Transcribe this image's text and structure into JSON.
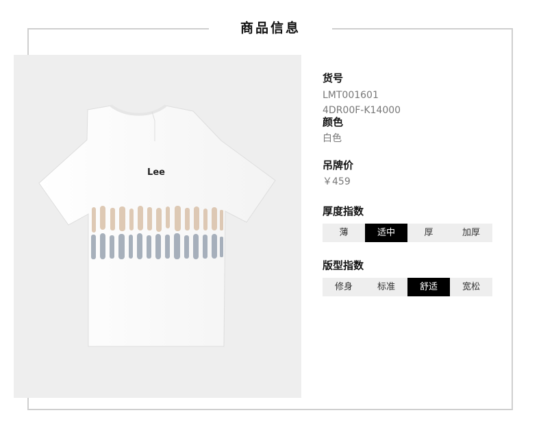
{
  "header": {
    "title": "商品信息"
  },
  "product": {
    "logo_text": "Lee",
    "sku_label": "货号",
    "sku_values": [
      "LMT001601",
      "4DR00F-K14000"
    ],
    "color_label": "颜色",
    "color_value": "白色",
    "price_label": "吊牌价",
    "price_value": "￥459"
  },
  "thickness": {
    "label": "厚度指数",
    "options": [
      "薄",
      "适中",
      "厚",
      "加厚"
    ],
    "selected_index": 1
  },
  "fit": {
    "label": "版型指数",
    "options": [
      "修身",
      "标准",
      "舒适",
      "宽松"
    ],
    "selected_index": 2
  },
  "colors": {
    "panel_bg": "#eeeeee",
    "shirt": "#fafafa",
    "selected_bg": "#000000",
    "stripe_tan": "#dbc4ad",
    "stripe_gray": "#9ea8b5"
  }
}
